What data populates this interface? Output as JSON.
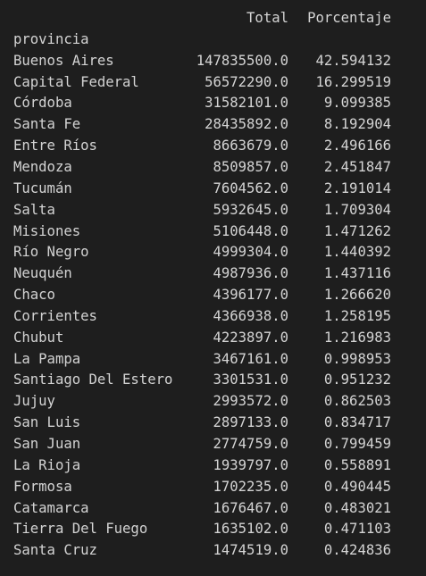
{
  "table": {
    "columns": [
      "Total",
      "Porcentaje"
    ],
    "index_name": "provincia",
    "rows": [
      {
        "provincia": "Buenos Aires",
        "total": "147835500.0",
        "porcentaje": "42.594132"
      },
      {
        "provincia": "Capital Federal",
        "total": "56572290.0",
        "porcentaje": "16.299519"
      },
      {
        "provincia": "Córdoba",
        "total": "31582101.0",
        "porcentaje": "9.099385"
      },
      {
        "provincia": "Santa Fe",
        "total": "28435892.0",
        "porcentaje": "8.192904"
      },
      {
        "provincia": "Entre Ríos",
        "total": "8663679.0",
        "porcentaje": "2.496166"
      },
      {
        "provincia": "Mendoza",
        "total": "8509857.0",
        "porcentaje": "2.451847"
      },
      {
        "provincia": "Tucumán",
        "total": "7604562.0",
        "porcentaje": "2.191014"
      },
      {
        "provincia": "Salta",
        "total": "5932645.0",
        "porcentaje": "1.709304"
      },
      {
        "provincia": "Misiones",
        "total": "5106448.0",
        "porcentaje": "1.471262"
      },
      {
        "provincia": "Río Negro",
        "total": "4999304.0",
        "porcentaje": "1.440392"
      },
      {
        "provincia": "Neuquén",
        "total": "4987936.0",
        "porcentaje": "1.437116"
      },
      {
        "provincia": "Chaco",
        "total": "4396177.0",
        "porcentaje": "1.266620"
      },
      {
        "provincia": "Corrientes",
        "total": "4366938.0",
        "porcentaje": "1.258195"
      },
      {
        "provincia": "Chubut",
        "total": "4223897.0",
        "porcentaje": "1.216983"
      },
      {
        "provincia": "La Pampa",
        "total": "3467161.0",
        "porcentaje": "0.998953"
      },
      {
        "provincia": "Santiago Del Estero",
        "total": "3301531.0",
        "porcentaje": "0.951232"
      },
      {
        "provincia": "Jujuy",
        "total": "2993572.0",
        "porcentaje": "0.862503"
      },
      {
        "provincia": "San Luis",
        "total": "2897133.0",
        "porcentaje": "0.834717"
      },
      {
        "provincia": "San Juan",
        "total": "2774759.0",
        "porcentaje": "0.799459"
      },
      {
        "provincia": "La Rioja",
        "total": "1939797.0",
        "porcentaje": "0.558891"
      },
      {
        "provincia": "Formosa",
        "total": "1702235.0",
        "porcentaje": "0.490445"
      },
      {
        "provincia": "Catamarca",
        "total": "1676467.0",
        "porcentaje": "0.483021"
      },
      {
        "provincia": "Tierra Del Fuego",
        "total": "1635102.0",
        "porcentaje": "0.471103"
      },
      {
        "provincia": "Santa Cruz",
        "total": "1474519.0",
        "porcentaje": "0.424836"
      }
    ]
  }
}
